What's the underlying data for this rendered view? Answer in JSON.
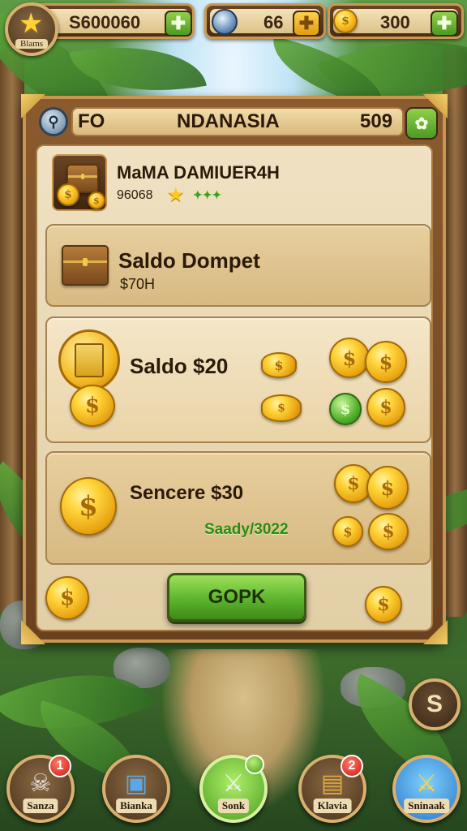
{
  "topbar": {
    "profile_label": "Blams",
    "gold_amount": "S600060",
    "gem_amount": "66",
    "coin_amount": "300"
  },
  "panel": {
    "header_left": "FO",
    "header_title": "NDANASIA",
    "header_amount": "509",
    "profile": {
      "name": "MaMA DAMIUER4H",
      "score": "96068"
    },
    "cards": {
      "dompet_title": "Saldo Dompet",
      "dompet_value": "$70H",
      "saldo_title": "Saldo $20",
      "sencere_title": "Sencere $30",
      "sencere_sub": "Saady/3022"
    },
    "ok_button": "GOPK"
  },
  "nav": {
    "items": [
      {
        "label": "Sanza",
        "badge": "1"
      },
      {
        "label": "Bianka",
        "badge": ""
      },
      {
        "label": "Sonk",
        "badge": ""
      },
      {
        "label": "Klavia",
        "badge": "2"
      },
      {
        "label": "Sninaak",
        "badge": ""
      }
    ]
  },
  "colors": {
    "accent_green": "#5cb42c",
    "gold": "#ffd53a",
    "wood": "#8a5b2e",
    "parchment": "#efe1c2"
  }
}
